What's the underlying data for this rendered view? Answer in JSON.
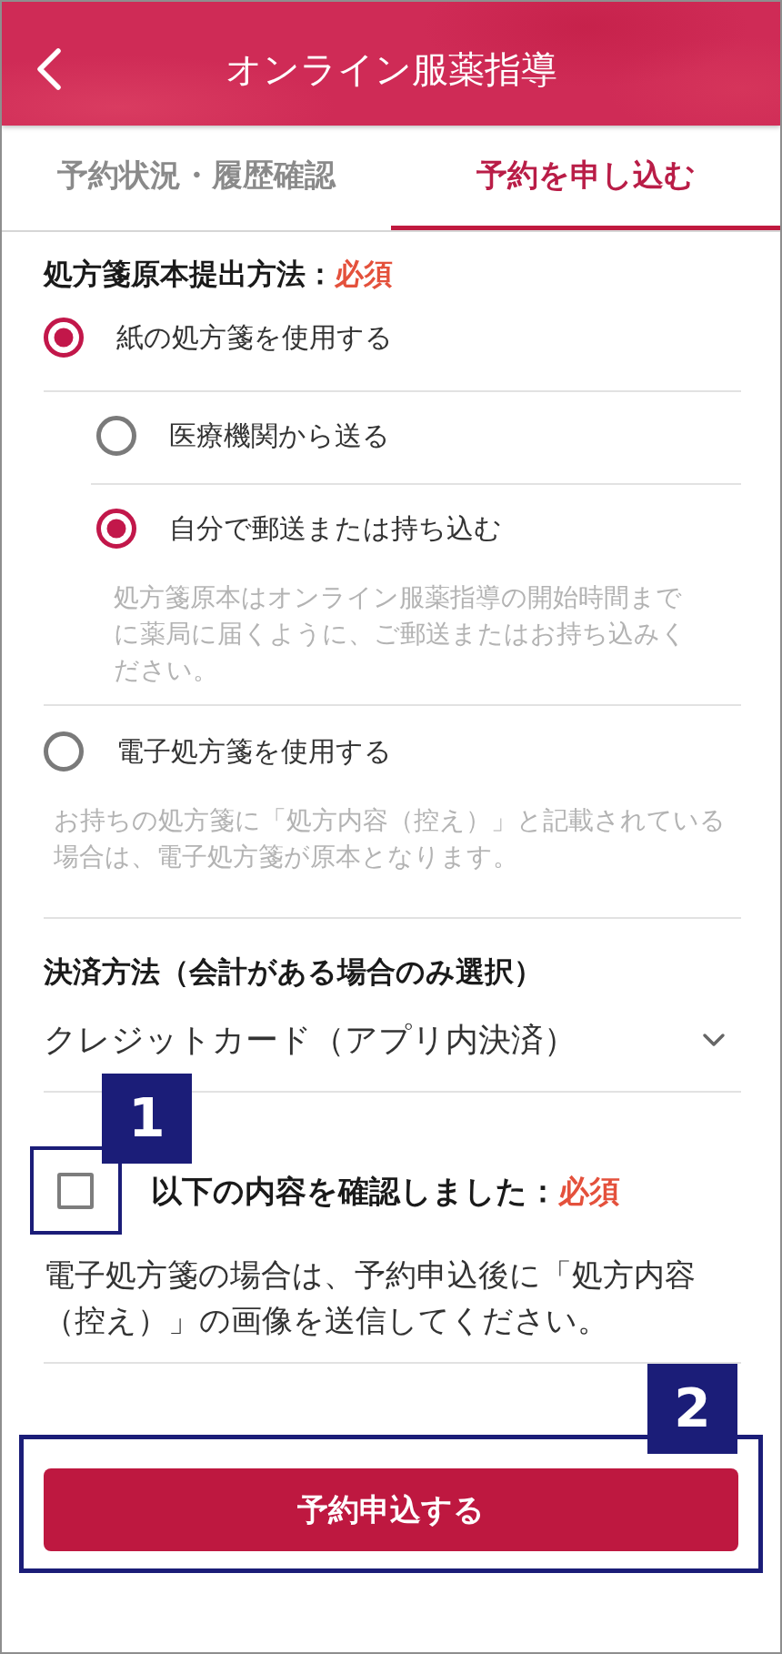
{
  "header": {
    "title": "オンライン服薬指導"
  },
  "tabs": [
    {
      "label": "予約状況・履歴確認",
      "selected": false
    },
    {
      "label": "予約を申し込む",
      "selected": true
    }
  ],
  "prescription_submission": {
    "label": "処方箋原本提出方法：",
    "required": "必須",
    "options": [
      {
        "label": "紙の処方箋を使用する",
        "selected": true,
        "children": [
          {
            "label": "医療機関から送る",
            "selected": false
          },
          {
            "label": "自分で郵送または持ち込む",
            "selected": true,
            "note": "処方箋原本はオンライン服薬指導の開始時間までに薬局に届くように、ご郵送またはお持ち込みください。"
          }
        ]
      },
      {
        "label": "電子処方箋を使用する",
        "selected": false,
        "note": "お持ちの処方箋に「処方内容（控え）」と記載されている場合は、電子処方箋が原本となります。"
      }
    ]
  },
  "payment": {
    "label": "決済方法（会計がある場合のみ選択）",
    "value": "クレジットカード（アプリ内決済）"
  },
  "confirmation": {
    "annotation": "1",
    "checked": false,
    "label": "以下の内容を確認しました：",
    "required": "必須",
    "note": "電子処方箋の場合は、予約申込後に「処方内容（控え）」の画像を送信してください。"
  },
  "submit_button": {
    "annotation": "2",
    "label": "予約申込する"
  }
}
